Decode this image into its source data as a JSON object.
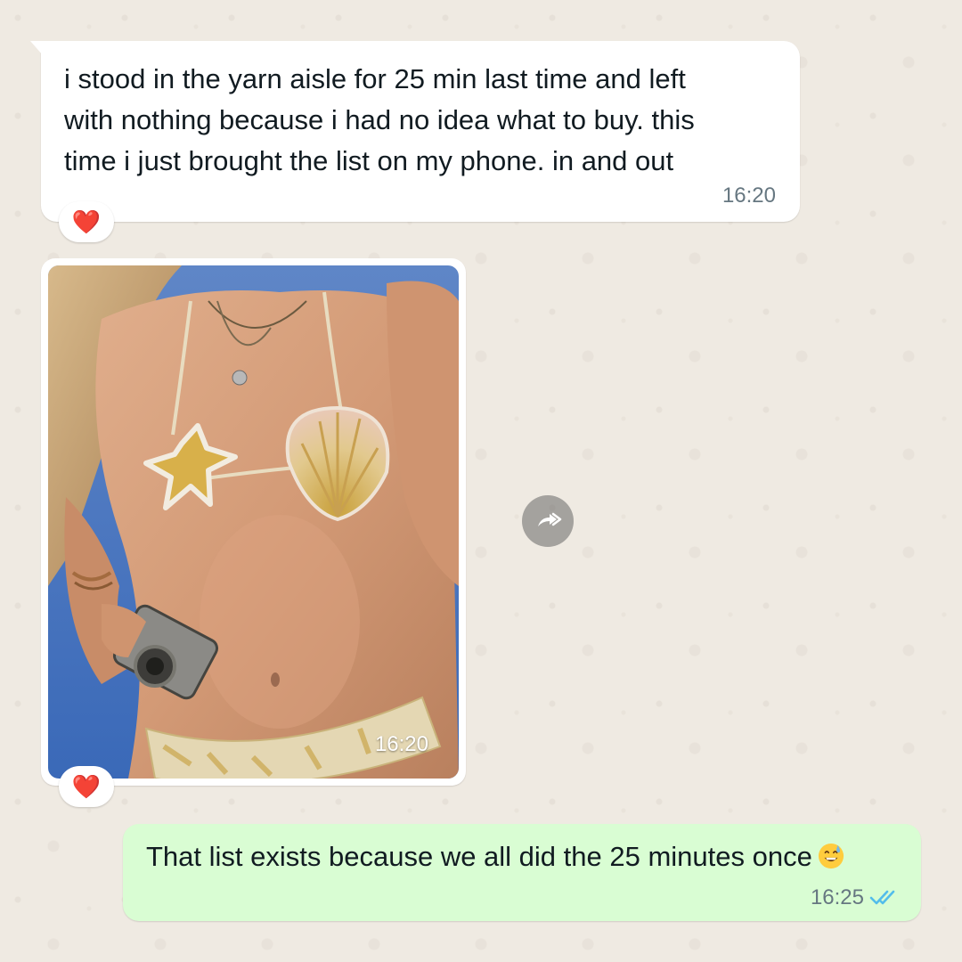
{
  "chat": {
    "messages": [
      {
        "direction": "incoming",
        "type": "text",
        "lines": [
          "i stood in the yarn aisle for 25 min last time and left",
          "with nothing because i had no idea what to buy. this",
          "time i just brought the list on my phone. in and out"
        ],
        "time": "16:20",
        "reaction": "❤️"
      },
      {
        "direction": "incoming",
        "type": "image",
        "time": "16:20",
        "reaction": "❤️",
        "action_icon": "forward-icon"
      },
      {
        "direction": "outgoing",
        "type": "text",
        "text": "That list exists because we all did the 25 minutes once",
        "emoji": "grinning-sweat-emoji",
        "time": "16:25",
        "status_icon": "double-check-read-icon",
        "status_color": "#53bdeb"
      }
    ]
  },
  "colors": {
    "incoming_bubble": "#ffffff",
    "outgoing_bubble": "#d9fdd3",
    "wallpaper": "#efeae2",
    "timestamp": "#667781"
  }
}
